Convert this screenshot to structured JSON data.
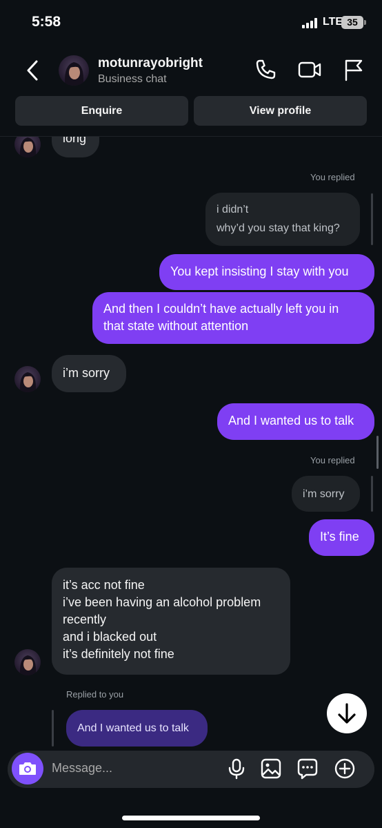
{
  "status_bar": {
    "time": "5:58",
    "network": "LTE",
    "battery": "35"
  },
  "header": {
    "username": "motunrayobright",
    "subtitle": "Business chat",
    "icons": [
      "back-chevron-icon",
      "phone-icon",
      "video-camera-icon",
      "flag-icon"
    ]
  },
  "actions": {
    "enquire": "Enquire",
    "view_profile": "View profile"
  },
  "messages": {
    "m0": "long",
    "reply1_label": "You replied",
    "quote1_line1": "i didn’t",
    "quote1_line2": "why’d you stay that king?",
    "m1": "You kept insisting I stay with you",
    "m2_line1": "And then I couldn’t have actually left you in",
    "m2_line2": "that state without attention",
    "m3": "i’m sorry",
    "m4": "And I wanted us to talk",
    "reply2_label": "You replied",
    "quote2": "i’m sorry",
    "m5": "It’s fine",
    "m6_line1": "it’s acc not fine",
    "m6_line2": "i’ve been having an alcohol problem",
    "m6_line3": "recently",
    "m6_line4": "and i blacked out",
    "m6_line5": "it’s definitely not fine",
    "reply3_label": "Replied to you",
    "quote3": "And I wanted us to talk"
  },
  "composer": {
    "placeholder": "Message...",
    "icons": [
      "camera-icon",
      "microphone-icon",
      "gallery-icon",
      "sticker-chat-icon",
      "plus-icon"
    ]
  },
  "colors": {
    "accent": "#7f3ff3",
    "background": "#0c1014",
    "incoming": "#262a2f"
  }
}
